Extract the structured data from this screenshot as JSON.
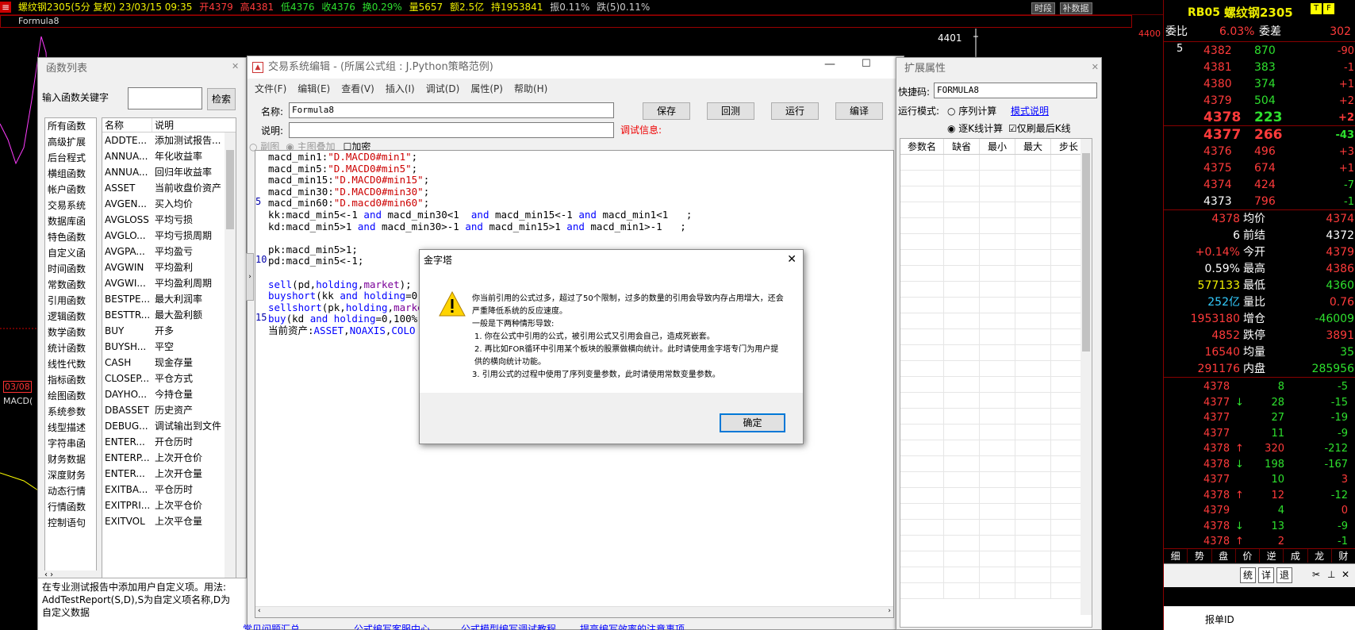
{
  "topbar": {
    "symbol_title": "螺纹钢2305(5分 复权) 23/03/15 09:35",
    "open": "开4379",
    "high": "高4381",
    "low": "低4376",
    "close": "收4376",
    "change": "换0.29%",
    "volume": "量5657",
    "amount": "额2.5亿",
    "position": "持1953841",
    "amplitude": "振0.11%",
    "drop": "跌(5)0.11%",
    "btn_time": "时段",
    "btn_fill": "补数据"
  },
  "formula_bar": {
    "name": "Formula8"
  },
  "chart": {
    "price_label": "4401",
    "price_label2": "4400",
    "date_label": "03/08",
    "macd_label": "MACD("
  },
  "quote": {
    "contract": "RB05",
    "name": "螺纹钢2305",
    "wb_label": "委比",
    "wb_value": "6.03%",
    "wc_label": "委差",
    "wc_value": "302",
    "depth_count": "5",
    "asks": [
      {
        "price": "4382",
        "vol": "870",
        "chg": "-90"
      },
      {
        "price": "4381",
        "vol": "383",
        "chg": "-1"
      },
      {
        "price": "4380",
        "vol": "374",
        "chg": "+1"
      },
      {
        "price": "4379",
        "vol": "504",
        "chg": "+2"
      },
      {
        "price": "4378",
        "vol": "223",
        "chg": "+2"
      }
    ],
    "bids": [
      {
        "price": "4377",
        "vol": "266",
        "chg": "-43"
      },
      {
        "price": "4376",
        "vol": "496",
        "chg": "+3"
      },
      {
        "price": "4375",
        "vol": "674",
        "chg": "+1"
      },
      {
        "price": "4374",
        "vol": "424",
        "chg": "-7"
      },
      {
        "price": "4373",
        "vol": "796",
        "chg": "-1"
      }
    ],
    "stats": [
      {
        "l": "4378",
        "k": "均价",
        "v": "4374"
      },
      {
        "l": "6",
        "k": "前结",
        "v": "4372"
      },
      {
        "l": "+0.14%",
        "k": "今开",
        "v": "4379"
      },
      {
        "l": "0.59%",
        "k": "最高",
        "v": "4386"
      },
      {
        "l": "577133",
        "k": "最低",
        "v": "4360"
      },
      {
        "l": "252亿",
        "k": "量比",
        "v": "0.76"
      },
      {
        "l": "1953180",
        "k": "增仓",
        "v": "-46009"
      },
      {
        "l": "4852",
        "k": "跌停",
        "v": "3891"
      },
      {
        "l": "16540",
        "k": "均量",
        "v": "35"
      },
      {
        "l": "291176",
        "k": "内盘",
        "v": "285956"
      }
    ],
    "ticks": [
      {
        "p": "4378",
        "a": "",
        "v": "8",
        "c": "-5"
      },
      {
        "p": "4377",
        "a": "↓",
        "v": "28",
        "c": "-15"
      },
      {
        "p": "4377",
        "a": "",
        "v": "27",
        "c": "-19"
      },
      {
        "p": "4377",
        "a": "",
        "v": "11",
        "c": "-9"
      },
      {
        "p": "4378",
        "a": "↑",
        "v": "320",
        "c": "-212"
      },
      {
        "p": "4378",
        "a": "↓",
        "v": "198",
        "c": "-167"
      },
      {
        "p": "4377",
        "a": "",
        "v": "10",
        "c": "3"
      },
      {
        "p": "4378",
        "a": "↑",
        "v": "12",
        "c": "-12"
      },
      {
        "p": "4379",
        "a": "",
        "v": "4",
        "c": "0"
      },
      {
        "p": "4378",
        "a": "↓",
        "v": "13",
        "c": "-9"
      },
      {
        "p": "4378",
        "a": "↑",
        "v": "2",
        "c": "-1"
      }
    ],
    "tabs": [
      "细",
      "势",
      "盘",
      "价",
      "逆",
      "成",
      "龙",
      "财"
    ],
    "bottom_btns": [
      "统",
      "详",
      "退"
    ],
    "order_id": "报单ID"
  },
  "funcwin": {
    "title": "函数列表",
    "search_label": "输入函数关键字",
    "search_btn": "检索",
    "categories": [
      "所有函数",
      "高级扩展",
      "后台程式",
      "横组函数",
      "帐户函数",
      "交易系统",
      "数据库函",
      "特色函数",
      "自定义函",
      "时间函数",
      "常数函数",
      "引用函数",
      "逻辑函数",
      "数学函数",
      "统计函数",
      "线性代数",
      "指标函数",
      "绘图函数",
      "系统参数",
      "线型描述",
      "字符串函",
      "财务数据",
      "深度财务",
      "动态行情",
      "行情函数",
      "控制语句"
    ],
    "col_name": "名称",
    "col_desc": "说明",
    "funcs": [
      {
        "n": "ADDTE...",
        "d": "添加测试报告..."
      },
      {
        "n": "ANNUA...",
        "d": "年化收益率"
      },
      {
        "n": "ANNUA...",
        "d": "回归年收益率"
      },
      {
        "n": "ASSET",
        "d": "当前收盘价资产"
      },
      {
        "n": "AVGEN...",
        "d": "买入均价"
      },
      {
        "n": "AVGLOSS",
        "d": "平均亏损"
      },
      {
        "n": "AVGLO...",
        "d": "平均亏损周期"
      },
      {
        "n": "AVGPA...",
        "d": "平均盈亏"
      },
      {
        "n": "AVGWIN",
        "d": "平均盈利"
      },
      {
        "n": "AVGWI...",
        "d": "平均盈利周期"
      },
      {
        "n": "BESTPE...",
        "d": "最大利润率"
      },
      {
        "n": "BESTTR...",
        "d": "最大盈利额"
      },
      {
        "n": "BUY",
        "d": "开多"
      },
      {
        "n": "BUYSH...",
        "d": "平空"
      },
      {
        "n": "CASH",
        "d": "现金存量"
      },
      {
        "n": "CLOSEP...",
        "d": "平仓方式"
      },
      {
        "n": "DAYHO...",
        "d": "今持仓量"
      },
      {
        "n": "DBASSET",
        "d": "历史资产"
      },
      {
        "n": "DEBUG...",
        "d": "调试输出到文件"
      },
      {
        "n": "ENTER...",
        "d": "开仓历时"
      },
      {
        "n": "ENTERP...",
        "d": "上次开仓价"
      },
      {
        "n": "ENTER...",
        "d": "上次开仓量"
      },
      {
        "n": "EXITBA...",
        "d": "平仓历时"
      },
      {
        "n": "EXITPRI...",
        "d": "上次平仓价"
      },
      {
        "n": "EXITVOL",
        "d": "上次平仓量"
      }
    ],
    "help_text": "在专业测试报告中添加用户自定义项。用法: AddTestReport(S,D),S为自定义项名称,D为自定义数据"
  },
  "editor": {
    "title": "交易系统编辑 - (所属公式组 : J.Python策略范例)",
    "menus": [
      "文件(F)",
      "编辑(E)",
      "查看(V)",
      "插入(I)",
      "调试(D)",
      "属性(P)",
      "帮助(H)"
    ],
    "name_label": "名称:",
    "name_value": "Formula8",
    "desc_label": "说明:",
    "debug_info": "调试信息:",
    "btn_save": "保存",
    "btn_rollback": "回测",
    "btn_run": "运行",
    "btn_compile": "编译",
    "btn_ok": "确定",
    "radio_sub": "副图",
    "radio_main": "主图叠加",
    "chk_encrypt": "加密",
    "line_numbers": [
      "5",
      "10",
      "15"
    ],
    "links": [
      "常见问题汇总",
      "公式编写客服中心",
      "公式模型编写调试教程",
      "提高编写效率的注意事项"
    ]
  },
  "ext": {
    "title": "扩展属性",
    "hotkey_label": "快捷码:",
    "hotkey_value": "FORMULA8",
    "mode_label": "运行模式:",
    "mode_seq": "序列计算",
    "mode_link": "模式说明",
    "mode_bar": "逐K线计算",
    "chk_last": "仅刷最后K线",
    "cols": [
      "参数名",
      "缺省",
      "最小",
      "最大",
      "步长"
    ]
  },
  "dialog": {
    "title": "金字塔",
    "msg1": "你当前引用的公式过多，超过了50个限制，过多的数量的引用会导致内存占用增大，还会严重降低系统的反应速度。",
    "msg2": "一般是下两种情形导致:",
    "item1": "1. 你在公式中引用的公式，被引用公式又引用会自己，造成死嵌套。",
    "item2": "2. 再比如FOR循环中引用某个板块的股票做横向统计。此时请使用金字塔专门为用户提供的横向统计功能。",
    "item3": "3. 引用公式的过程中使用了序列变量参数，此时请使用常数变量参数。",
    "ok": "确定"
  }
}
